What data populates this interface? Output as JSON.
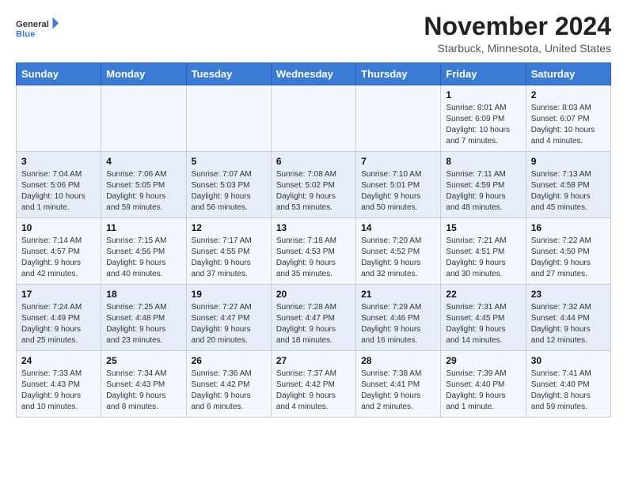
{
  "header": {
    "logo_general": "General",
    "logo_blue": "Blue",
    "month_title": "November 2024",
    "location": "Starbuck, Minnesota, United States"
  },
  "weekdays": [
    "Sunday",
    "Monday",
    "Tuesday",
    "Wednesday",
    "Thursday",
    "Friday",
    "Saturday"
  ],
  "weeks": [
    [
      {
        "day": "",
        "info": ""
      },
      {
        "day": "",
        "info": ""
      },
      {
        "day": "",
        "info": ""
      },
      {
        "day": "",
        "info": ""
      },
      {
        "day": "",
        "info": ""
      },
      {
        "day": "1",
        "info": "Sunrise: 8:01 AM\nSunset: 6:09 PM\nDaylight: 10 hours and 7 minutes."
      },
      {
        "day": "2",
        "info": "Sunrise: 8:03 AM\nSunset: 6:07 PM\nDaylight: 10 hours and 4 minutes."
      }
    ],
    [
      {
        "day": "3",
        "info": "Sunrise: 7:04 AM\nSunset: 5:06 PM\nDaylight: 10 hours and 1 minute."
      },
      {
        "day": "4",
        "info": "Sunrise: 7:06 AM\nSunset: 5:05 PM\nDaylight: 9 hours and 59 minutes."
      },
      {
        "day": "5",
        "info": "Sunrise: 7:07 AM\nSunset: 5:03 PM\nDaylight: 9 hours and 56 minutes."
      },
      {
        "day": "6",
        "info": "Sunrise: 7:08 AM\nSunset: 5:02 PM\nDaylight: 9 hours and 53 minutes."
      },
      {
        "day": "7",
        "info": "Sunrise: 7:10 AM\nSunset: 5:01 PM\nDaylight: 9 hours and 50 minutes."
      },
      {
        "day": "8",
        "info": "Sunrise: 7:11 AM\nSunset: 4:59 PM\nDaylight: 9 hours and 48 minutes."
      },
      {
        "day": "9",
        "info": "Sunrise: 7:13 AM\nSunset: 4:58 PM\nDaylight: 9 hours and 45 minutes."
      }
    ],
    [
      {
        "day": "10",
        "info": "Sunrise: 7:14 AM\nSunset: 4:57 PM\nDaylight: 9 hours and 42 minutes."
      },
      {
        "day": "11",
        "info": "Sunrise: 7:15 AM\nSunset: 4:56 PM\nDaylight: 9 hours and 40 minutes."
      },
      {
        "day": "12",
        "info": "Sunrise: 7:17 AM\nSunset: 4:55 PM\nDaylight: 9 hours and 37 minutes."
      },
      {
        "day": "13",
        "info": "Sunrise: 7:18 AM\nSunset: 4:53 PM\nDaylight: 9 hours and 35 minutes."
      },
      {
        "day": "14",
        "info": "Sunrise: 7:20 AM\nSunset: 4:52 PM\nDaylight: 9 hours and 32 minutes."
      },
      {
        "day": "15",
        "info": "Sunrise: 7:21 AM\nSunset: 4:51 PM\nDaylight: 9 hours and 30 minutes."
      },
      {
        "day": "16",
        "info": "Sunrise: 7:22 AM\nSunset: 4:50 PM\nDaylight: 9 hours and 27 minutes."
      }
    ],
    [
      {
        "day": "17",
        "info": "Sunrise: 7:24 AM\nSunset: 4:49 PM\nDaylight: 9 hours and 25 minutes."
      },
      {
        "day": "18",
        "info": "Sunrise: 7:25 AM\nSunset: 4:48 PM\nDaylight: 9 hours and 23 minutes."
      },
      {
        "day": "19",
        "info": "Sunrise: 7:27 AM\nSunset: 4:47 PM\nDaylight: 9 hours and 20 minutes."
      },
      {
        "day": "20",
        "info": "Sunrise: 7:28 AM\nSunset: 4:47 PM\nDaylight: 9 hours and 18 minutes."
      },
      {
        "day": "21",
        "info": "Sunrise: 7:29 AM\nSunset: 4:46 PM\nDaylight: 9 hours and 16 minutes."
      },
      {
        "day": "22",
        "info": "Sunrise: 7:31 AM\nSunset: 4:45 PM\nDaylight: 9 hours and 14 minutes."
      },
      {
        "day": "23",
        "info": "Sunrise: 7:32 AM\nSunset: 4:44 PM\nDaylight: 9 hours and 12 minutes."
      }
    ],
    [
      {
        "day": "24",
        "info": "Sunrise: 7:33 AM\nSunset: 4:43 PM\nDaylight: 9 hours and 10 minutes."
      },
      {
        "day": "25",
        "info": "Sunrise: 7:34 AM\nSunset: 4:43 PM\nDaylight: 9 hours and 8 minutes."
      },
      {
        "day": "26",
        "info": "Sunrise: 7:36 AM\nSunset: 4:42 PM\nDaylight: 9 hours and 6 minutes."
      },
      {
        "day": "27",
        "info": "Sunrise: 7:37 AM\nSunset: 4:42 PM\nDaylight: 9 hours and 4 minutes."
      },
      {
        "day": "28",
        "info": "Sunrise: 7:38 AM\nSunset: 4:41 PM\nDaylight: 9 hours and 2 minutes."
      },
      {
        "day": "29",
        "info": "Sunrise: 7:39 AM\nSunset: 4:40 PM\nDaylight: 9 hours and 1 minute."
      },
      {
        "day": "30",
        "info": "Sunrise: 7:41 AM\nSunset: 4:40 PM\nDaylight: 8 hours and 59 minutes."
      }
    ]
  ]
}
